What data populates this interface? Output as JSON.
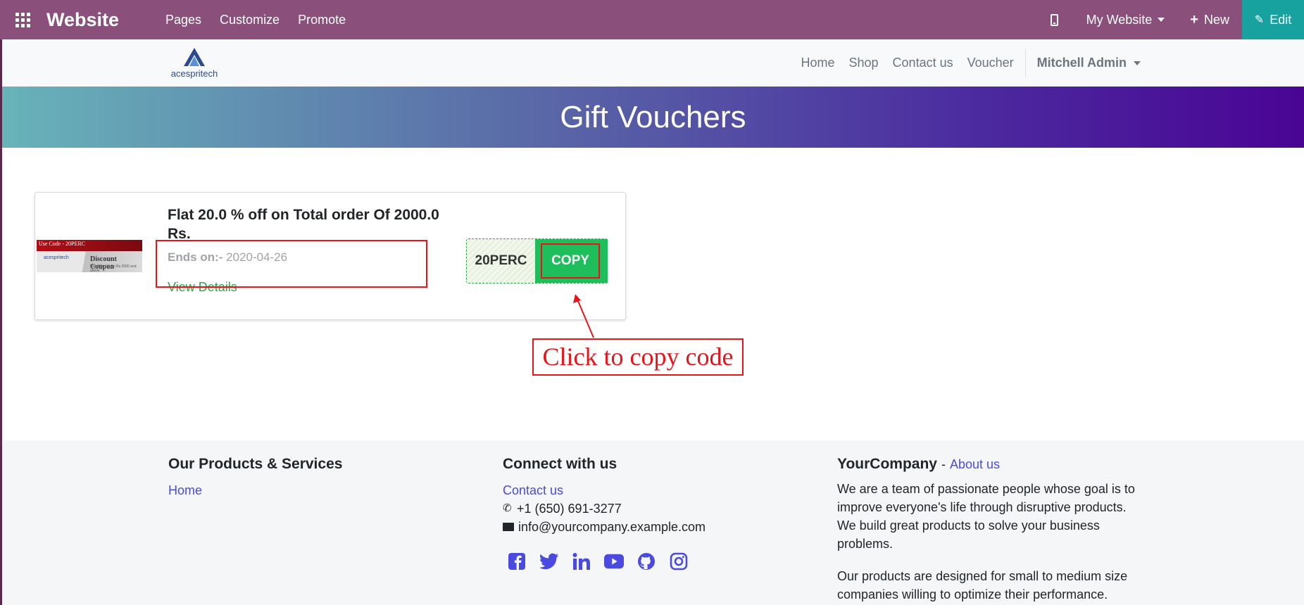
{
  "admin_bar": {
    "brand": "Website",
    "menu": [
      "Pages",
      "Customize",
      "Promote"
    ],
    "my_website": "My Website",
    "new_label": "New",
    "edit_label": "Edit"
  },
  "site_header": {
    "logo_text": "acespritech",
    "nav": [
      "Home",
      "Shop",
      "Contact us",
      "Voucher"
    ],
    "user": "Mitchell Admin"
  },
  "banner": {
    "title": "Gift Vouchers"
  },
  "voucher": {
    "image_top_text": "Use Code - 20PERC",
    "image_main_text": "Discount Coupon",
    "image_small_text": "Flat 20% Off On Rs 2000 and above",
    "image_logo_text": "acespritech",
    "title": "Flat 20.0 % off on Total order Of 2000.0 Rs.",
    "ends_label": "Ends on:-",
    "ends_date": "2020-04-26",
    "view_details": "View Details",
    "code": "20PERC",
    "copy_label": "COPY"
  },
  "annotation": {
    "callout": "Click to copy code"
  },
  "footer": {
    "col1": {
      "title": "Our Products & Services",
      "links": [
        "Home"
      ]
    },
    "col2": {
      "title": "Connect with us",
      "contact_link": "Contact us",
      "phone": "+1 (650) 691-3277",
      "email": "info@yourcompany.example.com",
      "social_icons": [
        "facebook-icon",
        "twitter-icon",
        "linkedin-icon",
        "youtube-icon",
        "github-icon",
        "instagram-icon"
      ]
    },
    "col3": {
      "company": "YourCompany",
      "separator": "-",
      "about": "About us",
      "para1": "We are a team of passionate people whose goal is to improve everyone's life through disruptive products. We build great products to solve your business problems.",
      "para2": "Our products are designed for small to medium size companies willing to optimize their performance."
    }
  },
  "colors": {
    "admin_bar": "#8b4f7c",
    "edit_button": "#17a2a0",
    "copy_button": "#1ebe5d",
    "link": "#4a4ae0",
    "annotation": "#e8141a"
  }
}
